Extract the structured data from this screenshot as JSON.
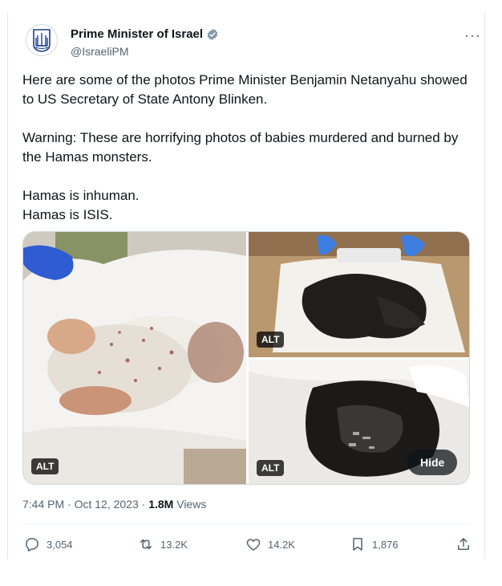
{
  "account": {
    "display_name": "Prime Minister of Israel",
    "handle": "@IsraeliPM",
    "verified_badge_color": "#829aab",
    "avatar_icon": "state-emblem-icon"
  },
  "menu": {
    "more_label": "···"
  },
  "tweet": {
    "paragraphs": [
      "Here are some of the photos Prime Minister Benjamin Netanyahu showed to US Secretary of State Antony Blinken.",
      "Warning: These are horrifying photos of babies murdered and burned by the Hamas monsters.",
      "Hamas is inhuman.",
      "Hamas is ISIS."
    ]
  },
  "media": {
    "alt_label": "ALT",
    "hide_label": "Hide"
  },
  "meta": {
    "time": "7:44 PM",
    "separator": " · ",
    "date": "Oct 12, 2023",
    "views_count": "1.8M",
    "views_label": " Views"
  },
  "actions": {
    "replies": "3,054",
    "reposts": "13.2K",
    "likes": "14.2K",
    "bookmarks": "1,876"
  },
  "colors": {
    "text_primary": "#0f1419",
    "text_secondary": "#536471",
    "border": "#cfd9de",
    "emblem_blue": "#1a3d8f"
  }
}
